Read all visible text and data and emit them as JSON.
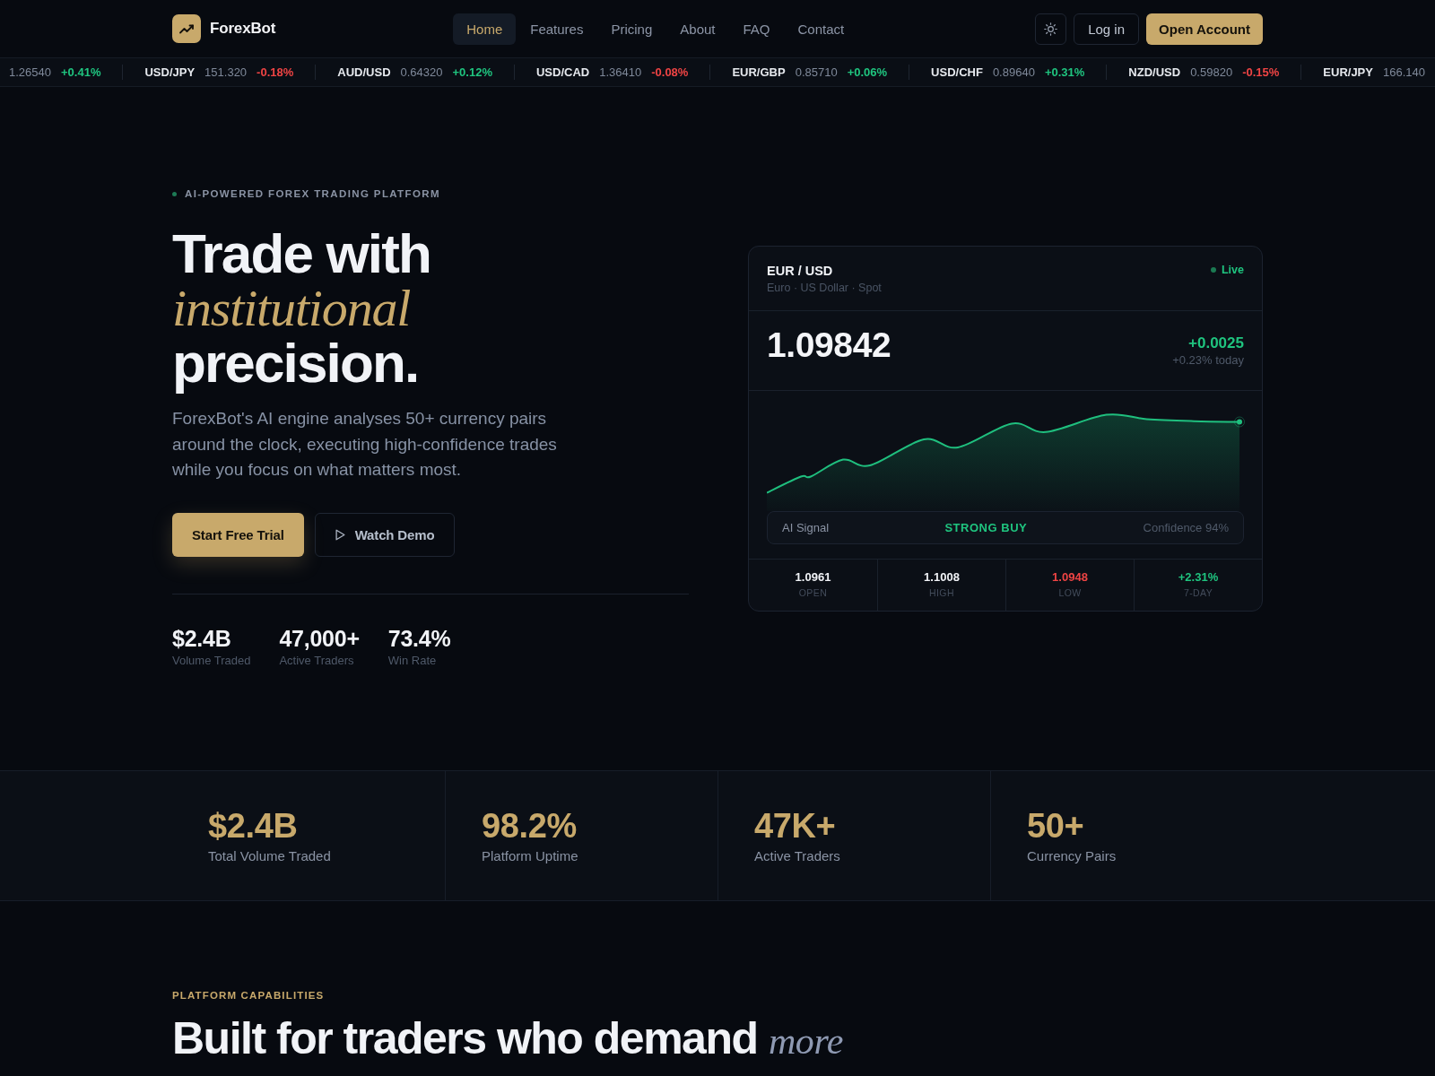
{
  "nav": {
    "brand": "ForexBot",
    "links": [
      {
        "label": "Home",
        "selected": true
      },
      {
        "label": "Features",
        "selected": false
      },
      {
        "label": "Pricing",
        "selected": false
      },
      {
        "label": "About",
        "selected": false
      },
      {
        "label": "FAQ",
        "selected": false
      },
      {
        "label": "Contact",
        "selected": false
      }
    ],
    "login": "Log in",
    "cta": "Open Account"
  },
  "ticker": [
    {
      "price": "1.26540",
      "change": "+0.41%",
      "color": "#1fc47f"
    },
    {
      "pair": "USD/JPY",
      "price": "151.320",
      "change": "-0.18%",
      "color": "#ef4444"
    },
    {
      "pair": "AUD/USD",
      "price": "0.64320",
      "change": "+0.12%",
      "color": "#1fc47f"
    },
    {
      "pair": "USD/CAD",
      "price": "1.36410",
      "change": "-0.08%",
      "color": "#ef4444"
    },
    {
      "pair": "EUR/GBP",
      "price": "0.85710",
      "change": "+0.06%",
      "color": "#1fc47f"
    },
    {
      "pair": "USD/CHF",
      "price": "0.89640",
      "change": "+0.31%",
      "color": "#1fc47f"
    },
    {
      "pair": "NZD/USD",
      "price": "0.59820",
      "change": "-0.15%",
      "color": "#ef4444"
    },
    {
      "pair": "EUR/JPY",
      "price": "166.140"
    }
  ],
  "hero": {
    "eyebrow": "AI-POWERED FOREX TRADING PLATFORM",
    "title": "Trade with *institutional* precision.",
    "lead": "ForexBot's AI engine analyses 50+ currency pairs around the clock, executing high-confidence trades while you focus on what matters most.",
    "primary_button": "Start Free Trial",
    "secondary_button": "Watch Demo",
    "stats": [
      {
        "value": "$2.4B",
        "label": "Volume Traded"
      },
      {
        "value": "47,000+",
        "label": "Active Traders"
      },
      {
        "value": "73.4%",
        "label": "Win Rate"
      }
    ]
  },
  "quote_card": {
    "pair": "EUR / USD",
    "subtitle": "Euro · US Dollar · Spot",
    "status": "Live",
    "price": "1.09842",
    "change": "+0.0025",
    "change_pct": "+0.23% today",
    "signal": {
      "label": "AI Signal",
      "value": "STRONG BUY",
      "confidence": "Confidence 94%"
    },
    "stats": [
      {
        "value": "1.0961",
        "label": "OPEN",
        "color": "#f1f3f7"
      },
      {
        "value": "1.1008",
        "label": "HIGH",
        "color": "#f1f3f7"
      },
      {
        "value": "1.0948",
        "label": "LOW",
        "color": "#ef4444"
      },
      {
        "value": "+2.31%",
        "label": "7-DAY",
        "color": "#1fc47f"
      }
    ]
  },
  "metrics": [
    {
      "value": "$2.4B",
      "label": "Total Volume Traded"
    },
    {
      "value": "98.2%",
      "label": "Platform Uptime"
    },
    {
      "value": "47K+",
      "label": "Active Traders"
    },
    {
      "value": "50+",
      "label": "Currency Pairs"
    }
  ],
  "capabilities": {
    "eyebrow": "PLATFORM CAPABILITIES",
    "title": "Built for traders who demand *more*"
  }
}
